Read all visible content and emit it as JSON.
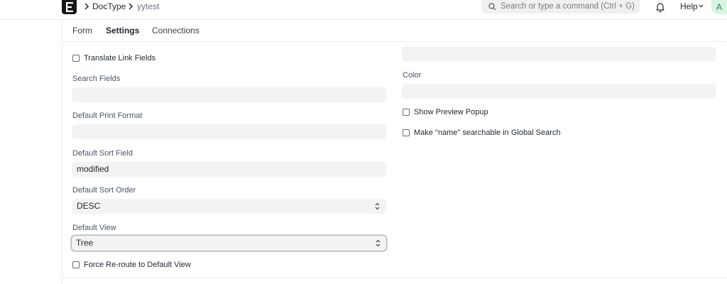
{
  "breadcrumb": {
    "doctype": "DocType",
    "record": "yytest"
  },
  "search": {
    "placeholder": "Search or type a command (Ctrl + G)"
  },
  "navbar": {
    "help_label": "Help",
    "avatar_initial": "A"
  },
  "tabs": [
    {
      "label": "Form",
      "selected": false
    },
    {
      "label": "Settings",
      "selected": true
    },
    {
      "label": "Connections",
      "selected": false
    }
  ],
  "left_column": {
    "translate_link_fields": {
      "label": "Translate Link Fields",
      "checked": false
    },
    "search_fields": {
      "label": "Search Fields",
      "value": ""
    },
    "default_print_format": {
      "label": "Default Print Format",
      "value": ""
    },
    "default_sort_field": {
      "label": "Default Sort Field",
      "value": "modified"
    },
    "default_sort_order": {
      "label": "Default Sort Order",
      "value": "DESC"
    },
    "default_view": {
      "label": "Default View",
      "value": "Tree"
    },
    "force_reroute": {
      "label": "Force Re-route to Default View",
      "checked": false
    }
  },
  "right_column": {
    "top_field": {
      "value": ""
    },
    "color": {
      "label": "Color",
      "value": ""
    },
    "show_preview_popup": {
      "label": "Show Preview Popup",
      "checked": false
    },
    "name_searchable": {
      "label": "Make \"name\" searchable in Global Search",
      "checked": false
    }
  },
  "colors": {
    "field_bg": "#f3f3f3",
    "logo_bg": "#171717",
    "avatar_bg": "#d8f5e1",
    "avatar_fg": "#2f7d4f"
  },
  "icons": {
    "logo": "frappe-logo-icon",
    "search": "search-icon",
    "bell": "bell-icon",
    "chevron": "chevron-right-icon",
    "select": "updown-icon"
  }
}
